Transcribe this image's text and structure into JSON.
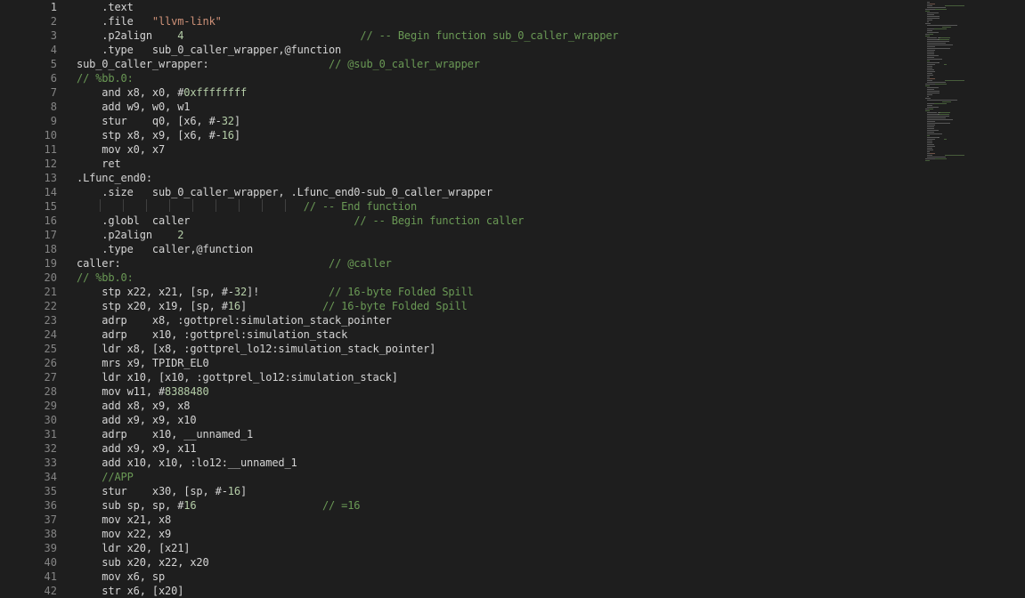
{
  "editor": {
    "language": "assembly",
    "colors": {
      "background": "#1e1e1e",
      "text": "#d4d4d4",
      "line_number": "#858585",
      "string": "#ce9178",
      "number": "#b5cea8",
      "comment": "#6a9955"
    },
    "lines": [
      {
        "n": "1",
        "tokens": [
          [
            "    .text",
            "t-plain"
          ]
        ]
      },
      {
        "n": "2",
        "tokens": [
          [
            "    .file   ",
            "t-plain"
          ],
          [
            "\"llvm-link\"",
            "t-str"
          ]
        ]
      },
      {
        "n": "3",
        "tokens": [
          [
            "    .p2align    ",
            "t-plain"
          ],
          [
            "4",
            "t-num"
          ],
          [
            "                            ",
            "t-plain"
          ],
          [
            "// -- Begin function sub_0_caller_wrapper",
            "t-cmt"
          ]
        ]
      },
      {
        "n": "4",
        "tokens": [
          [
            "    .type   sub_0_caller_wrapper,@function",
            "t-plain"
          ]
        ]
      },
      {
        "n": "5",
        "tokens": [
          [
            "sub_0_caller_wrapper:                   ",
            "t-plain"
          ],
          [
            "// @sub_0_caller_wrapper",
            "t-cmt"
          ]
        ]
      },
      {
        "n": "6",
        "tokens": [
          [
            "// %bb.0:",
            "t-cmt"
          ]
        ]
      },
      {
        "n": "7",
        "tokens": [
          [
            "    and x8, x0, #",
            "t-plain"
          ],
          [
            "0xffffffff",
            "t-num"
          ]
        ]
      },
      {
        "n": "8",
        "tokens": [
          [
            "    add w9, w0, w1",
            "t-plain"
          ]
        ]
      },
      {
        "n": "9",
        "tokens": [
          [
            "    stur    q0, [x6, #-",
            "t-plain"
          ],
          [
            "32",
            "t-num"
          ],
          [
            "]",
            "t-plain"
          ]
        ]
      },
      {
        "n": "10",
        "tokens": [
          [
            "    stp x8, x9, [x6, #-",
            "t-plain"
          ],
          [
            "16",
            "t-num"
          ],
          [
            "]",
            "t-plain"
          ]
        ]
      },
      {
        "n": "11",
        "tokens": [
          [
            "    mov x0, x7",
            "t-plain"
          ]
        ]
      },
      {
        "n": "12",
        "tokens": [
          [
            "    ret",
            "t-plain"
          ]
        ]
      },
      {
        "n": "13",
        "tokens": [
          [
            ".Lfunc_end0:",
            "t-plain"
          ]
        ]
      },
      {
        "n": "14",
        "tokens": [
          [
            "    .size   sub_0_caller_wrapper, .Lfunc_end0-sub_0_caller_wrapper",
            "t-plain"
          ]
        ]
      },
      {
        "n": "15",
        "tokens": [
          [
            "                                    ",
            "t-plain"
          ],
          [
            "// -- End function",
            "t-cmt"
          ]
        ]
      },
      {
        "n": "16",
        "tokens": [
          [
            "    .globl  caller                          ",
            "t-plain"
          ],
          [
            "// -- Begin function caller",
            "t-cmt"
          ]
        ]
      },
      {
        "n": "17",
        "tokens": [
          [
            "    .p2align    ",
            "t-plain"
          ],
          [
            "2",
            "t-num"
          ]
        ]
      },
      {
        "n": "18",
        "tokens": [
          [
            "    .type   caller,@function",
            "t-plain"
          ]
        ]
      },
      {
        "n": "19",
        "tokens": [
          [
            "caller:                                 ",
            "t-plain"
          ],
          [
            "// @caller",
            "t-cmt"
          ]
        ]
      },
      {
        "n": "20",
        "tokens": [
          [
            "// %bb.0:",
            "t-cmt"
          ]
        ]
      },
      {
        "n": "21",
        "tokens": [
          [
            "    stp x22, x21, [sp, #-",
            "t-plain"
          ],
          [
            "32",
            "t-num"
          ],
          [
            "]!           ",
            "t-plain"
          ],
          [
            "// 16-byte Folded Spill",
            "t-cmt"
          ]
        ]
      },
      {
        "n": "22",
        "tokens": [
          [
            "    stp x20, x19, [sp, #",
            "t-plain"
          ],
          [
            "16",
            "t-num"
          ],
          [
            "]            ",
            "t-plain"
          ],
          [
            "// 16-byte Folded Spill",
            "t-cmt"
          ]
        ]
      },
      {
        "n": "23",
        "tokens": [
          [
            "    adrp    x8, :gottprel:simulation_stack_pointer",
            "t-plain"
          ]
        ]
      },
      {
        "n": "24",
        "tokens": [
          [
            "    adrp    x10, :gottprel:simulation_stack",
            "t-plain"
          ]
        ]
      },
      {
        "n": "25",
        "tokens": [
          [
            "    ldr x8, [x8, :gottprel_lo12:simulation_stack_pointer]",
            "t-plain"
          ]
        ]
      },
      {
        "n": "26",
        "tokens": [
          [
            "    mrs x9, TPIDR_EL0",
            "t-plain"
          ]
        ]
      },
      {
        "n": "27",
        "tokens": [
          [
            "    ldr x10, [x10, :gottprel_lo12:simulation_stack]",
            "t-plain"
          ]
        ]
      },
      {
        "n": "28",
        "tokens": [
          [
            "    mov w11, #",
            "t-plain"
          ],
          [
            "8388480",
            "t-num"
          ]
        ]
      },
      {
        "n": "29",
        "tokens": [
          [
            "    add x8, x9, x8",
            "t-plain"
          ]
        ]
      },
      {
        "n": "30",
        "tokens": [
          [
            "    add x9, x9, x10",
            "t-plain"
          ]
        ]
      },
      {
        "n": "31",
        "tokens": [
          [
            "    adrp    x10, __unnamed_1",
            "t-plain"
          ]
        ]
      },
      {
        "n": "32",
        "tokens": [
          [
            "    add x9, x9, x11",
            "t-plain"
          ]
        ]
      },
      {
        "n": "33",
        "tokens": [
          [
            "    add x10, x10, :lo12:__unnamed_1",
            "t-plain"
          ]
        ]
      },
      {
        "n": "34",
        "tokens": [
          [
            "    //APP",
            "t-cmt"
          ]
        ]
      },
      {
        "n": "35",
        "tokens": [
          [
            "    stur    x30, [sp, #-",
            "t-plain"
          ],
          [
            "16",
            "t-num"
          ],
          [
            "]",
            "t-plain"
          ]
        ]
      },
      {
        "n": "36",
        "tokens": [
          [
            "    sub sp, sp, #",
            "t-plain"
          ],
          [
            "16",
            "t-num"
          ],
          [
            "                    ",
            "t-plain"
          ],
          [
            "// =16",
            "t-cmt"
          ]
        ]
      },
      {
        "n": "37",
        "tokens": [
          [
            "    mov x21, x8",
            "t-plain"
          ]
        ]
      },
      {
        "n": "38",
        "tokens": [
          [
            "    mov x22, x9",
            "t-plain"
          ]
        ]
      },
      {
        "n": "39",
        "tokens": [
          [
            "    ldr x20, [x21]",
            "t-plain"
          ]
        ]
      },
      {
        "n": "40",
        "tokens": [
          [
            "    sub x20, x22, x20",
            "t-plain"
          ]
        ]
      },
      {
        "n": "41",
        "tokens": [
          [
            "    mov x6, sp",
            "t-plain"
          ]
        ]
      },
      {
        "n": "42",
        "tokens": [
          [
            "    str x6, [x20]",
            "t-plain"
          ]
        ]
      }
    ],
    "active_line": "1"
  },
  "minimap": {
    "visible": true
  }
}
